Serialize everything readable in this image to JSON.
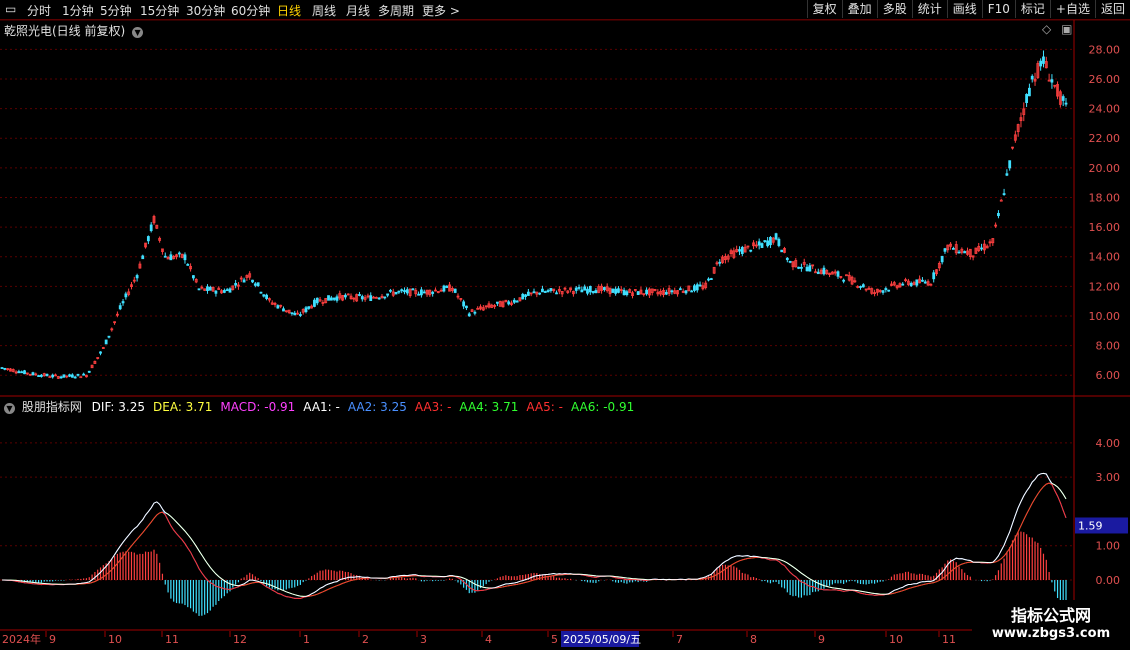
{
  "toolbar": {
    "periods": [
      "分时",
      "1分钟",
      "5分钟",
      "15分钟",
      "30分钟",
      "60分钟",
      "日线",
      "周线",
      "月线",
      "多周期",
      "更多 >"
    ],
    "active_period": "日线",
    "right_buttons": [
      "复权",
      "叠加",
      "多股",
      "统计",
      "画线",
      "F10",
      "标记",
      "+自选",
      "返回"
    ]
  },
  "price_panel": {
    "title": "乾照光电(日线 前复权)",
    "y_ticks": [
      "28.00",
      "26.00",
      "24.00",
      "22.00",
      "20.00",
      "18.00",
      "16.00",
      "14.00",
      "12.00",
      "10.00",
      "8.00",
      "6.00"
    ],
    "y_range": [
      5.0,
      28.9
    ]
  },
  "indicator_panel": {
    "name": "股朋指标网",
    "labels": [
      {
        "text": "DIF: 3.25",
        "color": "#ffffff"
      },
      {
        "text": "DEA: 3.71",
        "color": "#ffff40"
      },
      {
        "text": "MACD: -0.91",
        "color": "#ff40ff"
      },
      {
        "text": "AA1: -",
        "color": "#ffffff"
      },
      {
        "text": "AA2: 3.25",
        "color": "#4a90ff"
      },
      {
        "text": "AA3: -",
        "color": "#ff3030"
      },
      {
        "text": "AA4: 3.71",
        "color": "#30ff30"
      },
      {
        "text": "AA5: -",
        "color": "#ff3030"
      },
      {
        "text": "AA6: -0.91",
        "color": "#30ff30"
      }
    ],
    "y_ticks": [
      "4.00",
      "3.00",
      "1.59",
      "1.00",
      "0.00"
    ],
    "highlight_value": "1.59",
    "y_range": [
      -1.4,
      4.9
    ]
  },
  "date_axis": {
    "labels": [
      "2024年",
      "9",
      "10",
      "11",
      "12",
      "1",
      "2",
      "3",
      "4",
      "5",
      "2025/05/09/五",
      "7",
      "8",
      "9",
      "10",
      "11"
    ]
  },
  "watermark": {
    "line1": "指标公式网",
    "line2": "www.zbgs3.com"
  },
  "colors": {
    "up": "#ff4040",
    "down": "#40e0ff",
    "grid": "#5a0000",
    "dif": "#ffffff",
    "dea": "#ff3030",
    "aa4": "#30ff30",
    "aa2": "#4a90ff"
  }
}
